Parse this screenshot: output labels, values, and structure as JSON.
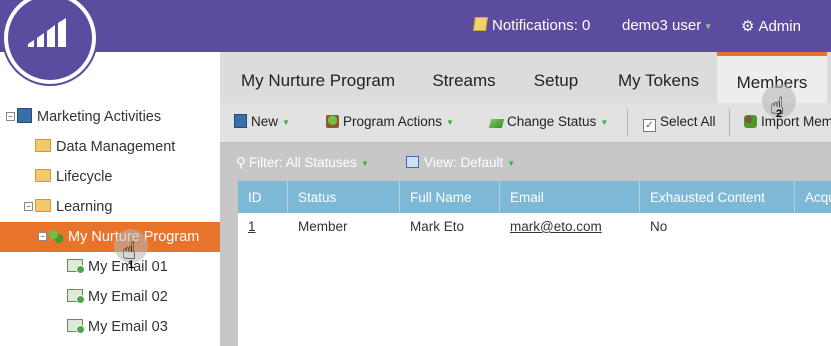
{
  "topbar": {
    "notifications_label": "Notifications: 0",
    "user_label": "demo3 user",
    "admin_label": "Admin"
  },
  "tree": {
    "items": [
      {
        "label": "Marketing Activities"
      },
      {
        "label": "Data Management"
      },
      {
        "label": "Lifecycle"
      },
      {
        "label": "Learning"
      },
      {
        "label": "My Nurture Program"
      },
      {
        "label": "My Email 01"
      },
      {
        "label": "My Email 02"
      },
      {
        "label": "My Email 03"
      }
    ]
  },
  "tabs": [
    "My Nurture Program",
    "Streams",
    "Setup",
    "My Tokens",
    "Members"
  ],
  "active_tab": "Members",
  "toolbar": {
    "new_label": "New",
    "program_actions_label": "Program Actions",
    "change_status_label": "Change Status",
    "select_all_label": "Select All",
    "import_members_label": "Import Mem"
  },
  "filterbar": {
    "filter_label": "Filter: All Statuses",
    "view_label": "View: Default"
  },
  "grid": {
    "columns": [
      "ID",
      "Status",
      "Full Name",
      "Email",
      "Exhausted Content",
      "Acqu"
    ],
    "rows": [
      {
        "id": "1",
        "status": "Member",
        "full_name": "Mark Eto",
        "email": "mark@eto.com",
        "exhausted_content": "No"
      }
    ]
  },
  "steps": {
    "step1": "1",
    "step2": "2"
  },
  "colors": {
    "brand_purple": "#5c4c9f",
    "accent_orange": "#e8732b",
    "grid_header_blue": "#7db9d6"
  }
}
